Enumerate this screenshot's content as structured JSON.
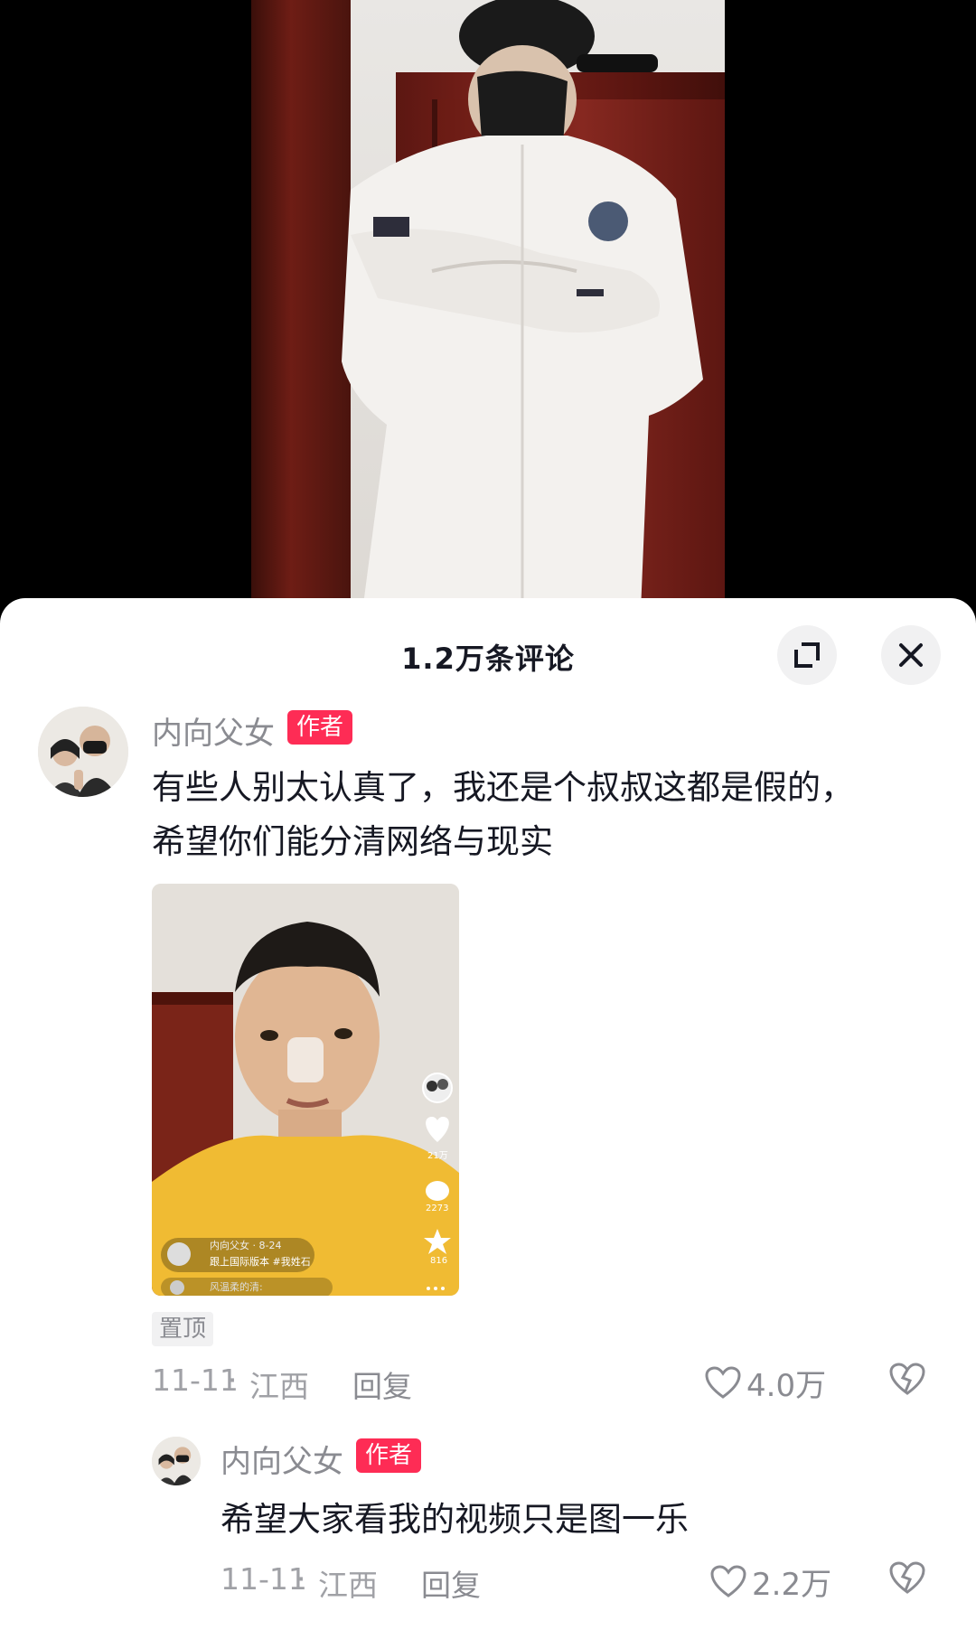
{
  "header": {
    "title": "1.2万条评论"
  },
  "comments": [
    {
      "username": "内向父女",
      "badge": "作者",
      "text_line1": "有些人别太认真了，我还是个叔叔这都是假的，",
      "text_line2": "希望你们能分清网络与现实",
      "pinned_label": "置顶",
      "date": "11-11",
      "separator": "·",
      "location": "江西",
      "reply_label": "回复",
      "like_count": "4.0万",
      "attachment": {
        "likes": "21万",
        "comments": "2273",
        "favorites": "816",
        "author_line": "内向父女 · 8-24",
        "caption": "跟上国际版本 #我姓石",
        "comment_preview": "风温柔的清:"
      }
    },
    {
      "username": "内向父女",
      "badge": "作者",
      "text": "希望大家看我的视频只是图一乐",
      "date": "11-11",
      "separator": "·",
      "location": "江西",
      "reply_label": "回复",
      "like_count": "2.2万"
    }
  ],
  "colors": {
    "accent": "#fe2c55",
    "text": "#161823",
    "muted": "#8a8b91"
  },
  "icons": [
    "expand-icon",
    "close-icon",
    "heart-icon",
    "dislike-icon"
  ]
}
